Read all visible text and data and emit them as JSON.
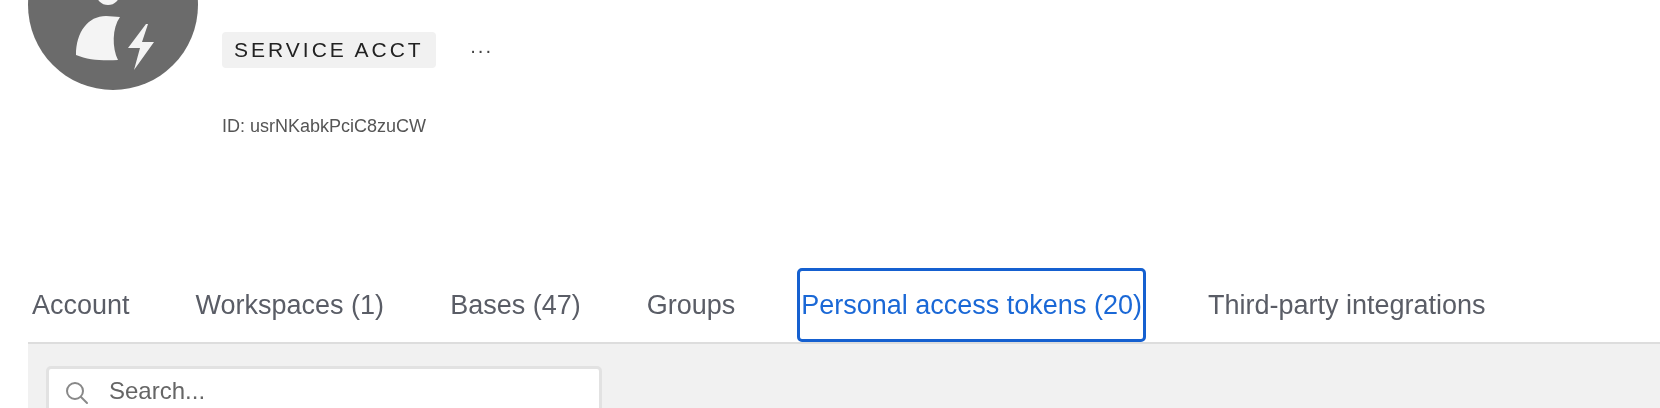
{
  "profile": {
    "badge": "SERVICE ACCT",
    "more": "···",
    "id_label": "ID: usrNKabkPciC8zuCW"
  },
  "tabs": [
    {
      "label": "Account",
      "selected": false
    },
    {
      "label": "Workspaces (1)",
      "selected": false
    },
    {
      "label": "Bases (47)",
      "selected": false
    },
    {
      "label": "Groups",
      "selected": false
    },
    {
      "label": "Personal access tokens (20)",
      "selected": true
    },
    {
      "label": "Third-party integrations",
      "selected": false
    }
  ],
  "search": {
    "placeholder": "Search..."
  }
}
